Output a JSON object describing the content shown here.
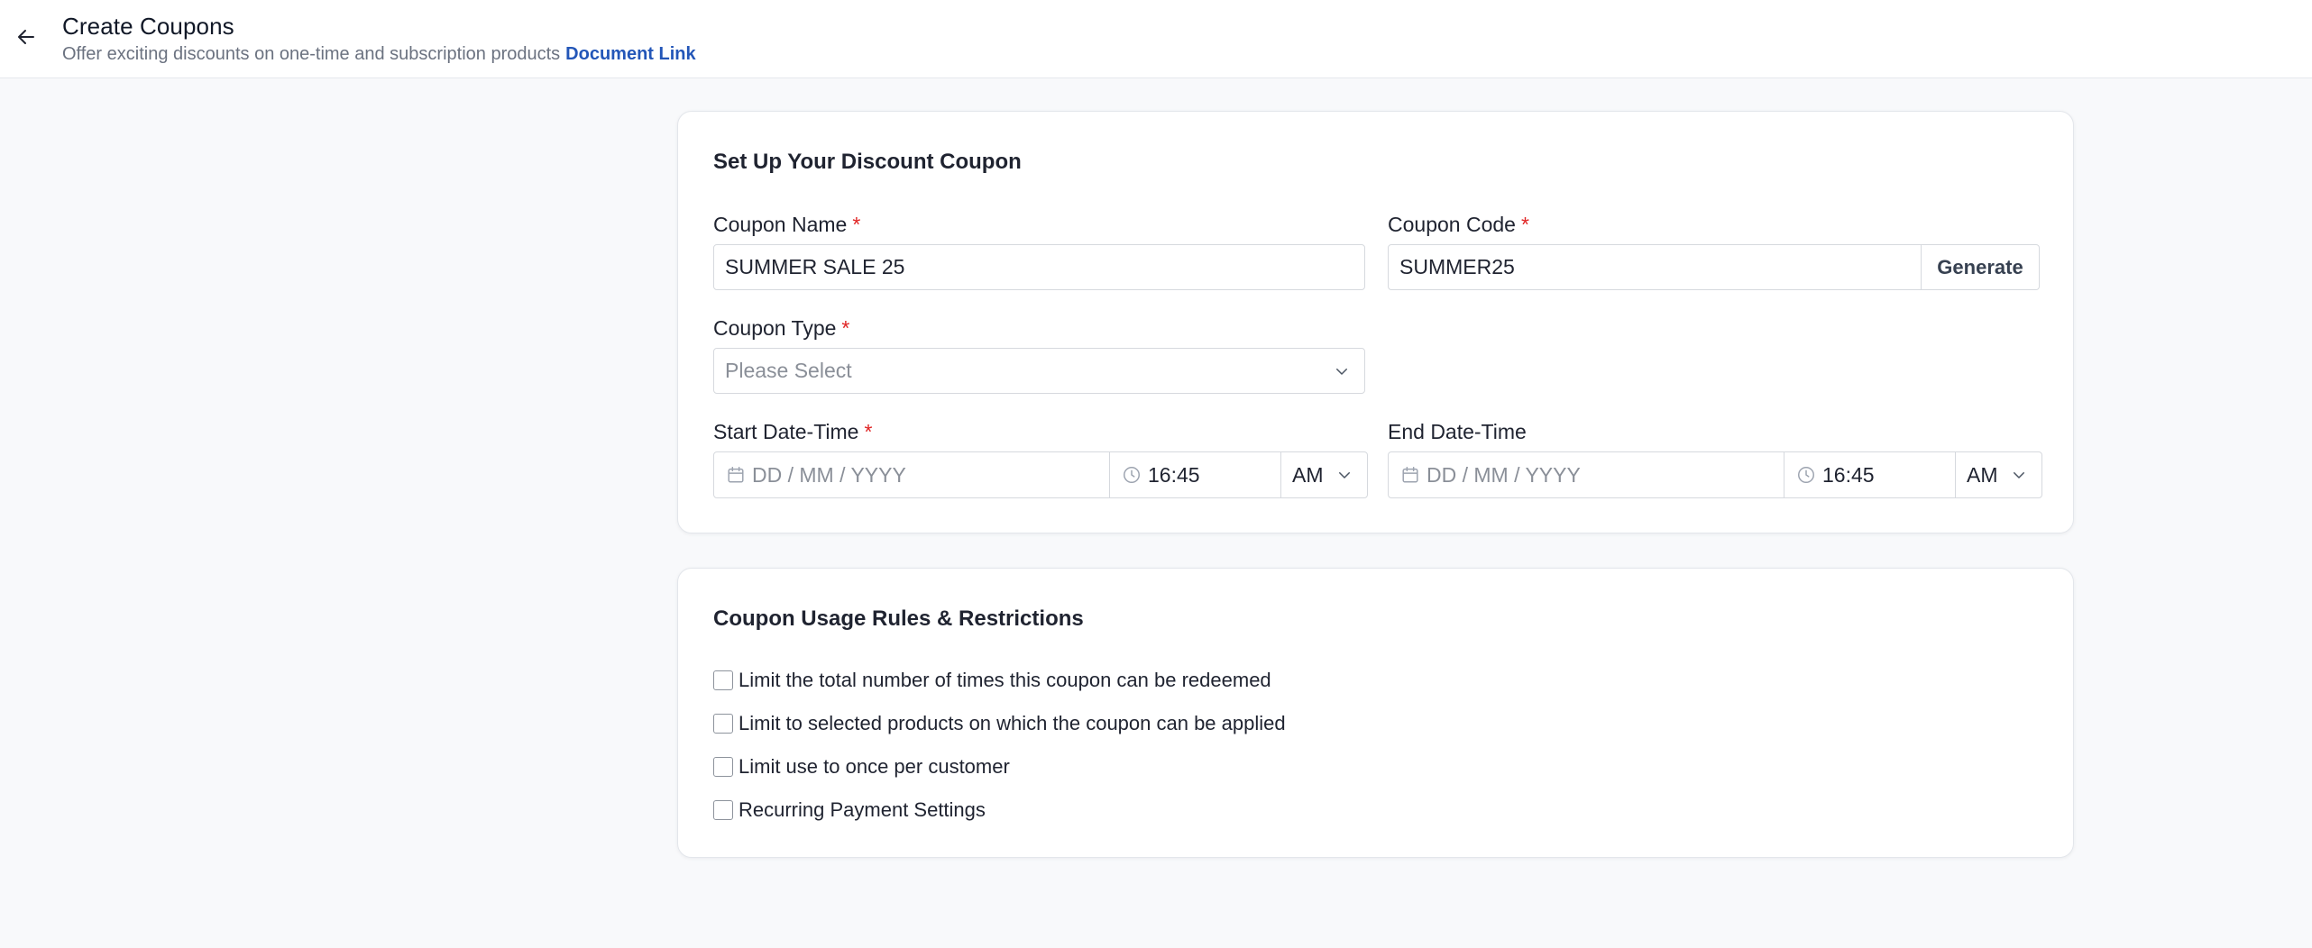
{
  "header": {
    "title": "Create Coupons",
    "subtitle": "Offer exciting discounts on one-time and subscription products",
    "doc_link": "Document Link"
  },
  "setup": {
    "title": "Set Up Your Discount Coupon",
    "coupon_name": {
      "label": "Coupon Name",
      "required": "*",
      "value": "SUMMER SALE 25"
    },
    "coupon_code": {
      "label": "Coupon Code",
      "required": "*",
      "value": "SUMMER25",
      "generate_label": "Generate"
    },
    "coupon_type": {
      "label": "Coupon Type",
      "required": "*",
      "placeholder": "Please Select"
    },
    "start": {
      "label": "Start Date-Time",
      "required": "*",
      "date_placeholder": "DD / MM / YYYY",
      "time": "16:45",
      "meridiem": "AM"
    },
    "end": {
      "label": "End Date-Time",
      "date_placeholder": "DD / MM / YYYY",
      "time": "16:45",
      "meridiem": "AM"
    }
  },
  "rules": {
    "title": "Coupon Usage Rules & Restrictions",
    "options": [
      "Limit the total number of times this coupon can be redeemed",
      "Limit to selected products on which the coupon can be applied",
      "Limit use to once per customer",
      "Recurring Payment Settings"
    ]
  },
  "colors": {
    "accent_link": "#2356b8",
    "required": "#e02424",
    "background": "#f8f9fb"
  },
  "icons": [
    "arrow-left-icon",
    "chevron-down-icon",
    "calendar-icon",
    "clock-icon"
  ]
}
